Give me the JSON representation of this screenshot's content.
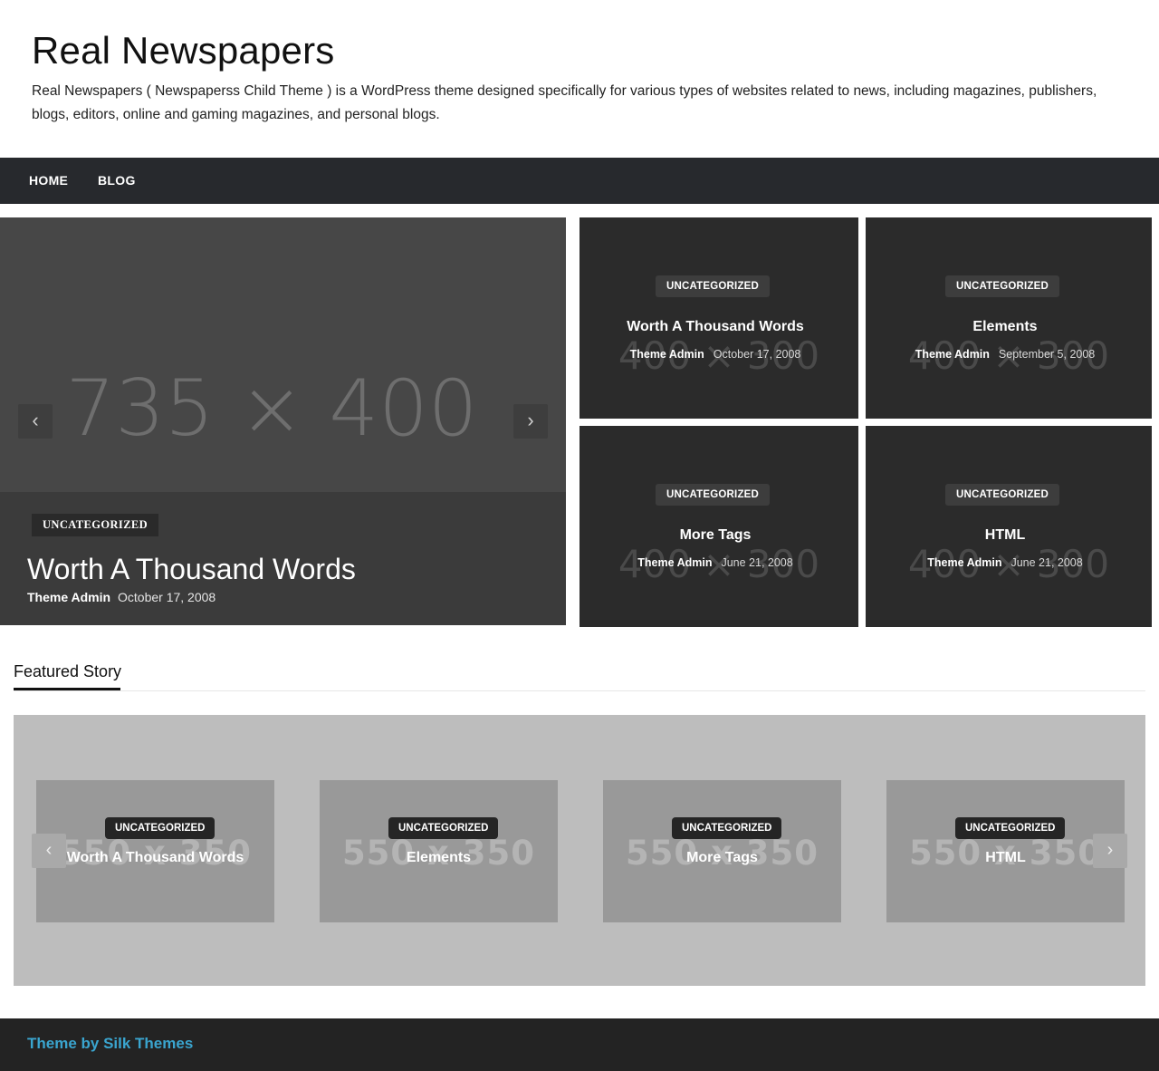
{
  "header": {
    "title": "Real Newspapers",
    "description": "Real Newspapers ( Newspaperss Child Theme ) is a WordPress theme designed specifically for various types of websites related to news, including magazines, publishers, blogs, editors, online and gaming magazines, and personal blogs."
  },
  "nav": {
    "items": [
      {
        "label": "HOME"
      },
      {
        "label": "BLOG"
      }
    ]
  },
  "hero": {
    "placeholder": "735 × 400",
    "category": "UNCATEGORIZED",
    "title": "Worth A Thousand Words",
    "author": "Theme Admin",
    "date": "October 17, 2008",
    "prev_icon": "chevron-left-icon",
    "next_icon": "chevron-right-icon"
  },
  "grid": {
    "cards": [
      {
        "placeholder": "400 × 300",
        "category": "UNCATEGORIZED",
        "title": "Worth A Thousand Words",
        "author": "Theme Admin",
        "date": "October 17, 2008"
      },
      {
        "placeholder": "400 × 300",
        "category": "UNCATEGORIZED",
        "title": "Elements",
        "author": "Theme Admin",
        "date": "September 5, 2008"
      },
      {
        "placeholder": "400 × 300",
        "category": "UNCATEGORIZED",
        "title": "More Tags",
        "author": "Theme Admin",
        "date": "June 21, 2008"
      },
      {
        "placeholder": "400 × 300",
        "category": "UNCATEGORIZED",
        "title": "HTML",
        "author": "Theme Admin",
        "date": "June 21, 2008"
      }
    ]
  },
  "featured": {
    "heading": "Featured Story",
    "cards": [
      {
        "placeholder": "550 x 350",
        "category": "UNCATEGORIZED",
        "title": "Worth A Thousand Words"
      },
      {
        "placeholder": "550 x 350",
        "category": "UNCATEGORIZED",
        "title": "Elements"
      },
      {
        "placeholder": "550 x 350",
        "category": "UNCATEGORIZED",
        "title": "More Tags"
      },
      {
        "placeholder": "550 x 350",
        "category": "UNCATEGORIZED",
        "title": "HTML"
      }
    ]
  },
  "footer": {
    "credit": "Theme by Silk Themes"
  },
  "colors": {
    "nav_bg": "#27292d",
    "footer_bg": "#232323",
    "footer_link": "#3aa5cf",
    "card_bg": "#2b2b2b"
  }
}
